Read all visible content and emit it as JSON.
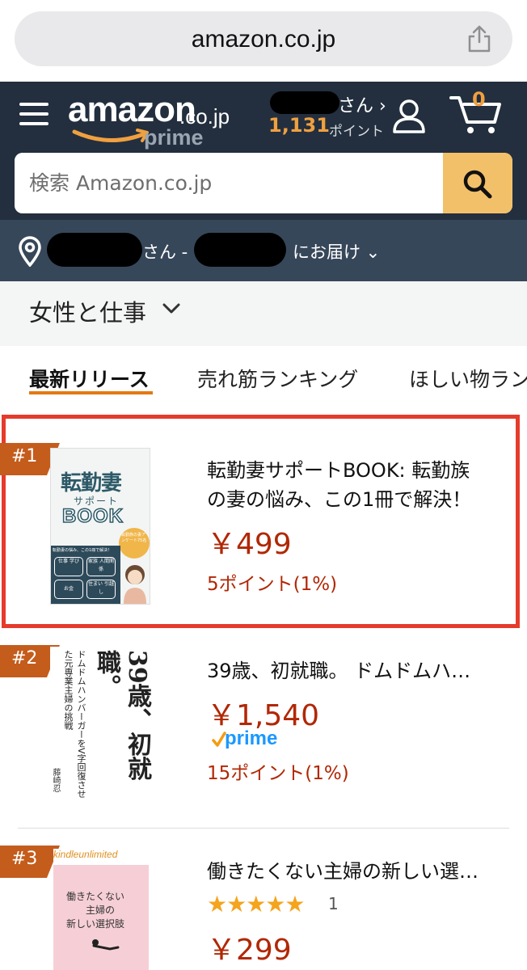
{
  "browser": {
    "url": "amazon.co.jp"
  },
  "header": {
    "logo_text": "amazon",
    "logo_tld": ".co.jp",
    "logo_prime": "prime",
    "account_suffix": "さん ›",
    "points_value": "1,131",
    "points_label": "ポイント",
    "cart_count": "0"
  },
  "search": {
    "placeholder": "検索 Amazon.co.jp"
  },
  "delivery": {
    "san": "さん -",
    "deliver_to": "にお届け ⌄"
  },
  "category": {
    "title": "女性と仕事"
  },
  "tabs": [
    {
      "label": "最新リリース"
    },
    {
      "label": "売れ筋ランキング"
    },
    {
      "label": "ほしい物ランキング"
    }
  ],
  "items": [
    {
      "rank": "#1",
      "title_line1": "転勤妻サポートBOOK: 転勤族",
      "title_line2": "の妻の悩み、この1冊で解決！",
      "price": "￥499",
      "points": "5ポイント(1%)",
      "cover": {
        "title": "転勤妻",
        "subtitle": "サポート",
        "book": "BOOK",
        "banner": "転勤妻の悩み、この1冊で解決！",
        "badge": "転勤族の妻アンケート75名",
        "grid": [
          "仕事 学び",
          "家族 人間関係",
          "お金",
          "住まい 引越し"
        ]
      }
    },
    {
      "rank": "#2",
      "title": "39歳、初就職。 ドムドムハ…",
      "price": "￥1,540",
      "prime": "prime",
      "points": "15ポイント(1%)",
      "cover": {
        "title_vertical": "39歳、初就職。",
        "subtitle_vertical": "ドムドムハンバーガーをV字回復させた元専業主婦の挑戦",
        "author": "藤崎忍"
      }
    },
    {
      "rank": "#3",
      "title": "働きたくない主婦の新しい選…",
      "rating": 5,
      "review_count": "1",
      "price": "￥299",
      "cover": {
        "badge": "kindleunlimited",
        "title_lines": [
          "働きたくない",
          "主婦の",
          "新しい選択肢"
        ]
      }
    }
  ],
  "colors": {
    "header_bg": "#232f3e",
    "delivery_bg": "#37475a",
    "accent_orange": "#e47911",
    "price_red": "#b12704",
    "rank_badge": "#c45c1c",
    "highlight_border": "#e53b2c",
    "star": "#f4a41d"
  }
}
